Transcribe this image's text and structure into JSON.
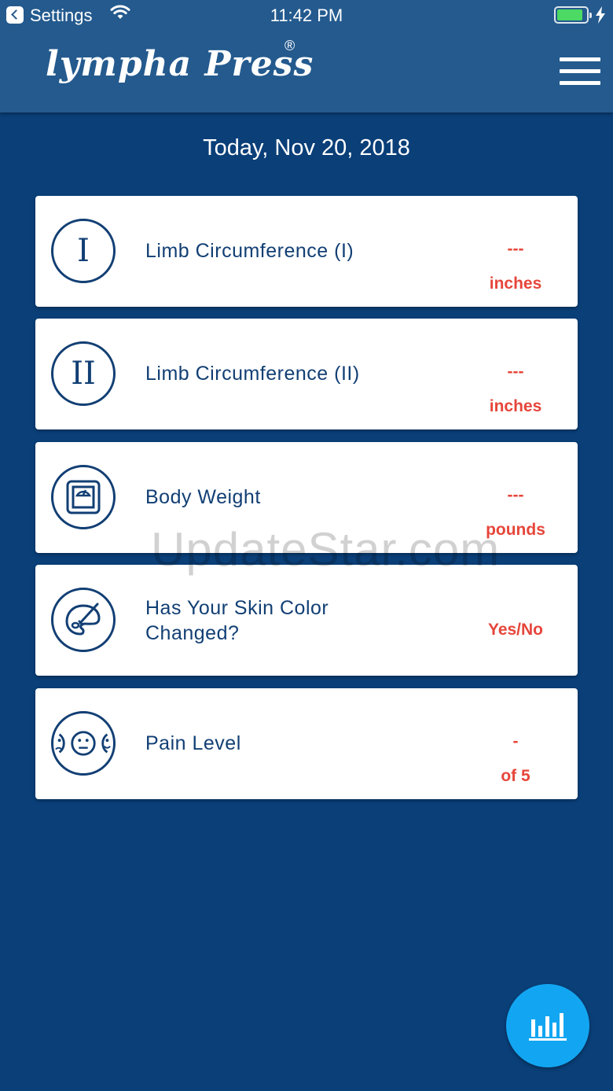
{
  "status_bar": {
    "back_label": "Settings",
    "time": "11:42 PM",
    "battery_level": 0.9
  },
  "header": {
    "brand": "lympha Press",
    "registered_mark": "®"
  },
  "date_title": "Today, Nov 20, 2018",
  "cards": [
    {
      "icon_text": "I",
      "label": "Limb Circumference (I)",
      "value": "---",
      "unit": "inches"
    },
    {
      "icon_text": "II",
      "label": "Limb Circumference (II)",
      "value": "---",
      "unit": "inches"
    },
    {
      "label": "Body Weight",
      "value": "---",
      "unit": "pounds"
    },
    {
      "label_line1": "Has Your Skin Color",
      "label_line2": "Changed?",
      "value": "Yes/No"
    },
    {
      "label": "Pain Level",
      "value": "-",
      "unit": "of 5"
    }
  ],
  "watermark": "UpdateStar.com",
  "colors": {
    "header_bg": "#245a8e",
    "screen_bg": "#0a3f78",
    "card_text": "#123f74",
    "value_text": "#e6463b",
    "fab_bg": "#12a6f2"
  },
  "icons": {
    "card_1": "roman-one-icon",
    "card_2": "roman-two-icon",
    "card_3": "scale-icon",
    "card_4": "palette-brush-icon",
    "card_5": "faces-icon",
    "fab": "bar-chart-icon"
  }
}
